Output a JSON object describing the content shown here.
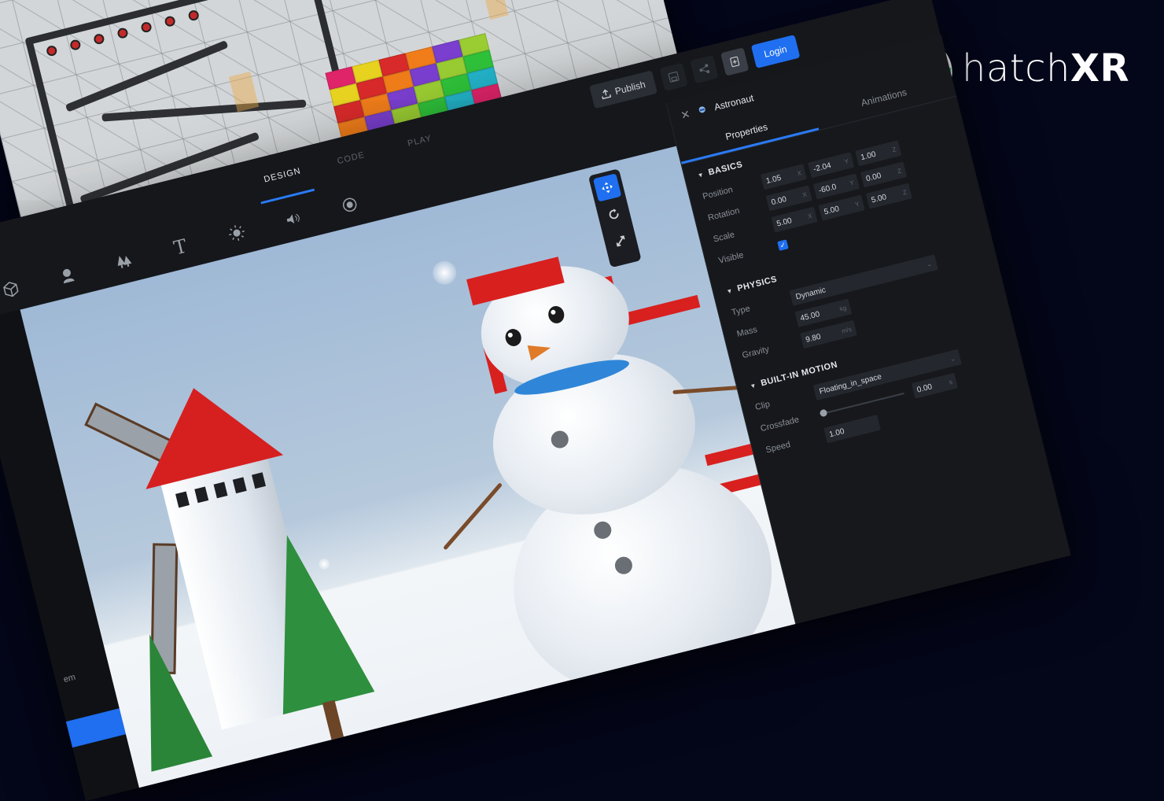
{
  "brand": {
    "name_light": "hatch",
    "name_bold": "XR"
  },
  "topbar": {
    "tabs": [
      {
        "label": "DESIGN",
        "active": true
      },
      {
        "label": "CODE",
        "active": false
      },
      {
        "label": "PLAY",
        "active": false
      }
    ],
    "publish_label": "Publish",
    "login_label": "Login"
  },
  "toolbar": {
    "tools": [
      "cube-icon",
      "avatar-icon",
      "trees-icon",
      "text-icon",
      "light-icon",
      "sound-icon",
      "record-icon"
    ],
    "text_tool_glyph": "T"
  },
  "side_panel": {
    "partial_text": "em"
  },
  "object": {
    "name": "Astronaut"
  },
  "panel_tabs": {
    "properties": "Properties",
    "animations": "Animations"
  },
  "basics": {
    "title": "BASICS",
    "position_label": "Position",
    "rotation_label": "Rotation",
    "scale_label": "Scale",
    "visible_label": "Visible",
    "position": [
      "1.05",
      "-2.04",
      "1.00"
    ],
    "rotation": [
      "0.00",
      "-60.0",
      "0.00"
    ],
    "scale": [
      "5.00",
      "5.00",
      "5.00"
    ],
    "axes": [
      "X",
      "Y",
      "Z"
    ],
    "visible": true
  },
  "physics": {
    "title": "PHYSICS",
    "type_label": "Type",
    "mass_label": "Mass",
    "gravity_label": "Gravity",
    "type": "Dynamic",
    "mass": "45.00",
    "mass_unit": "kg",
    "gravity": "9.80",
    "gravity_unit": "m/s"
  },
  "motion": {
    "title": "BUILT-IN MOTION",
    "clip_label": "Clip",
    "crossfade_label": "Crossfade",
    "speed_label": "Speed",
    "clip": "Floating_in_space",
    "crossfade": "0.00",
    "crossfade_unit": "s",
    "crossfade_level": 0,
    "speed": "1.00"
  },
  "colors": {
    "accent": "#1f6ff0",
    "background": "#04061a",
    "panel": "#16181c"
  }
}
